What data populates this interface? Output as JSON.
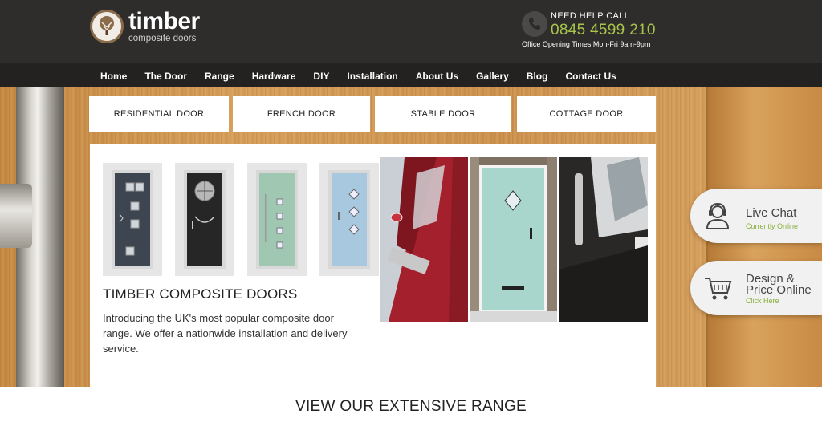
{
  "header": {
    "logo_name": "timber",
    "logo_sub": "composite doors",
    "help_label": "NEED HELP CALL",
    "phone": "0845 4599 210",
    "hours": "Office Opening Times Mon-Fri 9am-9pm"
  },
  "nav": {
    "items": [
      {
        "label": "Home"
      },
      {
        "label": "The Door"
      },
      {
        "label": "Range"
      },
      {
        "label": "Hardware"
      },
      {
        "label": "DIY"
      },
      {
        "label": "Installation"
      },
      {
        "label": "About Us"
      },
      {
        "label": "Gallery"
      },
      {
        "label": "Blog"
      },
      {
        "label": "Contact Us"
      }
    ]
  },
  "door_types": [
    {
      "label": "RESIDENTIAL DOOR"
    },
    {
      "label": "FRENCH DOOR"
    },
    {
      "label": "STABLE DOOR"
    },
    {
      "label": "COTTAGE DOOR"
    }
  ],
  "content": {
    "title": "TIMBER COMPOSITE DOORS",
    "text": "Introducing the UK's most popular composite door range. We offer a nationwide installation and delivery service."
  },
  "side": {
    "chat_title": "Live Chat",
    "chat_sub": "Currently Online",
    "design_title_1": "Design &",
    "design_title_2": "Price Online",
    "design_sub": "Click Here"
  },
  "bottom": {
    "title": "VIEW OUR EXTENSIVE RANGE"
  },
  "colors": {
    "header_bg": "#2e2d2b",
    "nav_bg": "#232220",
    "accent_green": "#a9c44a"
  },
  "icons": [
    "phone-icon",
    "tree-logo-icon",
    "headset-icon",
    "cart-icon"
  ]
}
